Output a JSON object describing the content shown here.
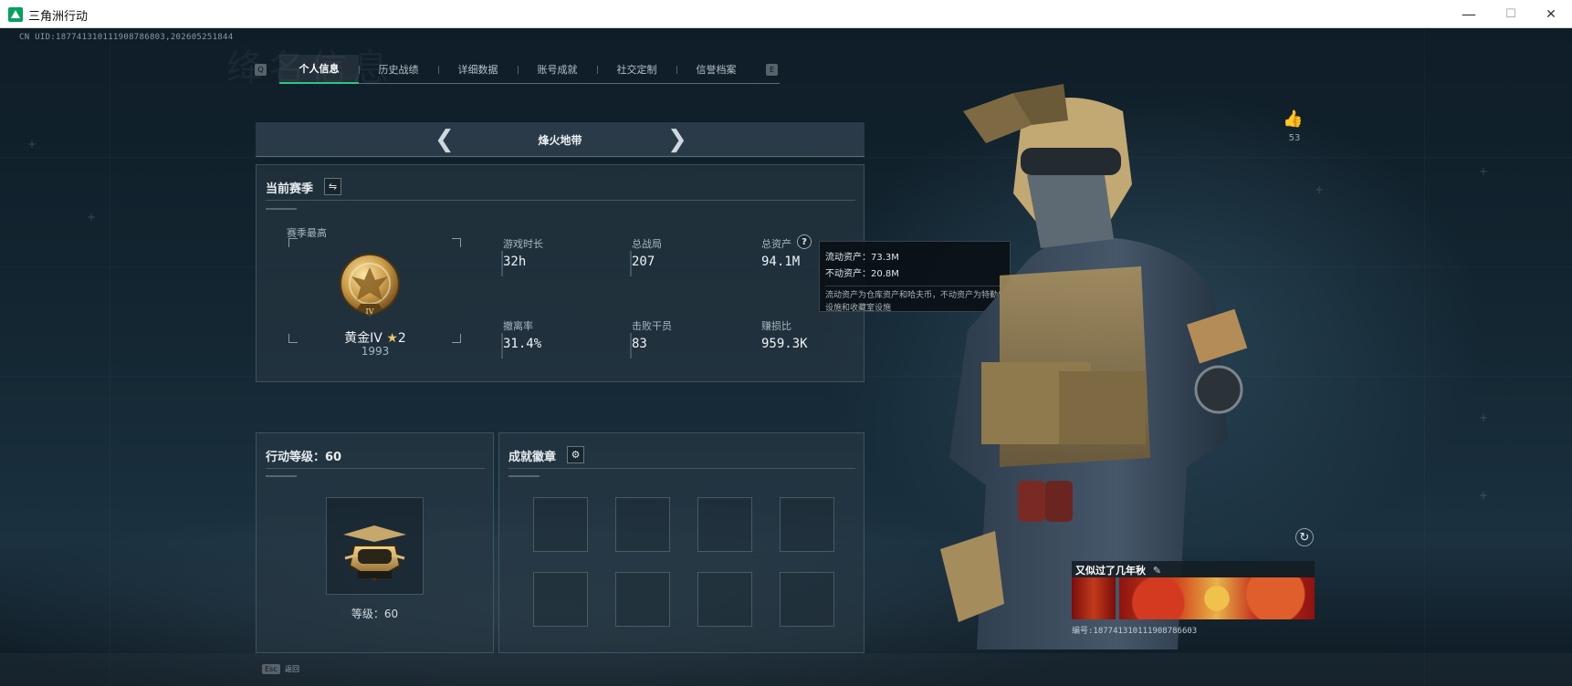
{
  "window": {
    "title": "三角洲行动",
    "minimize": "—",
    "maximize": "☐",
    "close": "✕"
  },
  "uid_text": "CN UID:1877413101119087868​03,202605251844",
  "bg_title": "绛名信息",
  "tabs": [
    {
      "label": "个人信息",
      "active": true
    },
    {
      "label": "历史战绩"
    },
    {
      "label": "详细数据"
    },
    {
      "label": "账号成就"
    },
    {
      "label": "社交定制"
    },
    {
      "label": "信誉档案"
    }
  ],
  "tab_key_left": "Q",
  "tab_key_right": "E",
  "mode": {
    "title": "烽火地带",
    "prev": "❮",
    "next": "❯"
  },
  "season": {
    "title": "当前赛季",
    "swap_icon": "⇋",
    "best_label": "赛季最高",
    "rank_name": "黄金IV",
    "rank_star": "★",
    "rank_stars": "2",
    "rank_score": "1993",
    "rank_badge_text": "IV",
    "stats": [
      {
        "label": "游戏时长",
        "value": "32h"
      },
      {
        "label": "总战局",
        "value": "207"
      },
      {
        "label": "总资产",
        "value": "94.1M",
        "help": "?"
      },
      {
        "label": "撤离率",
        "value": "31.4%"
      },
      {
        "label": "击败干员",
        "value": "83"
      },
      {
        "label": "赚损比",
        "value": "959.3K"
      }
    ]
  },
  "tooltip": {
    "liquid": "流动资产：73.3M",
    "fixed": "不动资产：20.8M",
    "desc": "流动资产为仓库资产和哈夫币，不动资产为特勤处设施和收藏室设施"
  },
  "level": {
    "title": "行动等级：60",
    "label": "等级：60"
  },
  "achievements": {
    "title": "成就徽章",
    "gear_icon": "⚙"
  },
  "likes": {
    "icon": "👍",
    "count": "53"
  },
  "card": {
    "title": "又似过了几年秋",
    "edit_icon": "✎",
    "id_text": "编号:187741310111908786603"
  },
  "refresh_icon": "↻",
  "bottom": {
    "esc": "Esc",
    "back": "返回"
  }
}
